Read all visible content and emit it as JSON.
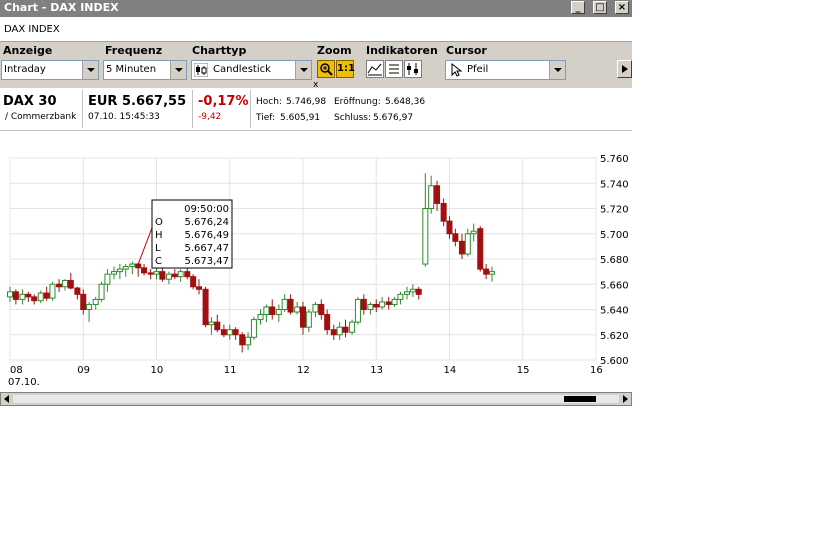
{
  "window": {
    "title": "Chart - DAX INDEX",
    "subtitle": "DAX INDEX"
  },
  "toolbar": {
    "anzeige_label": "Anzeige",
    "anzeige_value": "Intraday",
    "frequenz_label": "Frequenz",
    "frequenz_value": "5 Minuten",
    "charttyp_label": "Charttyp",
    "charttyp_value": "Candlestick",
    "zoom_label": "Zoom",
    "zoom_reset": "1:1",
    "indikatoren_label": "Indikatoren",
    "cursor_label": "Cursor",
    "cursor_value": "Pfeil",
    "close_x": "x"
  },
  "quote": {
    "name": "DAX 30",
    "exchange": "/ Commerzbank",
    "price": "EUR 5.667,55",
    "datetime": "07.10. 15:45:33",
    "change_pct": "-0,17%",
    "change_abs": "-9,42",
    "hoch_label": "Hoch:",
    "hoch_value": "5.746,98",
    "tief_label": "Tief:",
    "tief_value": "5.605,91",
    "eroeffnung_label": "Eröffnung:",
    "eroeffnung_value": "5.648,36",
    "schluss_label": "Schluss:",
    "schluss_value": "5.676,97"
  },
  "tooltip": {
    "time": "09:50:00",
    "O": "5.676,24",
    "H": "5.676,49",
    "L": "5.667,47",
    "C": "5.673,47"
  },
  "colors": {
    "up": "#2e8b2e",
    "down": "#a01010",
    "negative": "#c00000"
  },
  "chart_data": {
    "type": "candlestick",
    "y_ticks": [
      "5.760",
      "5.740",
      "5.720",
      "5.700",
      "5.680",
      "5.660",
      "5.640",
      "5.620",
      "5.600"
    ],
    "ylim": [
      5600,
      5760
    ],
    "x_ticks": [
      "08",
      "09",
      "10",
      "11",
      "12",
      "13",
      "14",
      "15",
      "16"
    ],
    "x_subtick": "07.10.",
    "grid": true,
    "xlim": [
      8,
      16
    ],
    "candles": [
      [
        8.0,
        5650,
        5658,
        5646,
        5654
      ],
      [
        8.08,
        5654,
        5656,
        5644,
        5648
      ],
      [
        8.17,
        5648,
        5656,
        5644,
        5652
      ],
      [
        8.25,
        5652,
        5654,
        5646,
        5650
      ],
      [
        8.33,
        5650,
        5652,
        5644,
        5647
      ],
      [
        8.42,
        5647,
        5655,
        5645,
        5653
      ],
      [
        8.5,
        5653,
        5658,
        5647,
        5649
      ],
      [
        8.58,
        5649,
        5662,
        5647,
        5660
      ],
      [
        8.67,
        5660,
        5664,
        5654,
        5658
      ],
      [
        8.75,
        5658,
        5664,
        5655,
        5663
      ],
      [
        8.83,
        5663,
        5669,
        5656,
        5657
      ],
      [
        8.92,
        5657,
        5658,
        5648,
        5652
      ],
      [
        9.0,
        5652,
        5656,
        5636,
        5640
      ],
      [
        9.08,
        5640,
        5646,
        5630,
        5644
      ],
      [
        9.17,
        5644,
        5650,
        5640,
        5648
      ],
      [
        9.25,
        5648,
        5662,
        5646,
        5660
      ],
      [
        9.33,
        5660,
        5672,
        5654,
        5668
      ],
      [
        9.42,
        5668,
        5674,
        5664,
        5670
      ],
      [
        9.5,
        5670,
        5676,
        5664,
        5672
      ],
      [
        9.58,
        5672,
        5676,
        5666,
        5674
      ],
      [
        9.67,
        5674,
        5678,
        5668,
        5676
      ],
      [
        9.75,
        5676,
        5677,
        5666,
        5673
      ],
      [
        9.83,
        5673,
        5676,
        5667,
        5669
      ],
      [
        9.92,
        5669,
        5672,
        5664,
        5668
      ],
      [
        10.0,
        5668,
        5674,
        5664,
        5670
      ],
      [
        10.08,
        5670,
        5674,
        5662,
        5664
      ],
      [
        10.17,
        5664,
        5670,
        5660,
        5668
      ],
      [
        10.25,
        5668,
        5672,
        5664,
        5666
      ],
      [
        10.33,
        5666,
        5672,
        5662,
        5670
      ],
      [
        10.42,
        5670,
        5674,
        5664,
        5666
      ],
      [
        10.5,
        5666,
        5668,
        5656,
        5658
      ],
      [
        10.58,
        5658,
        5664,
        5652,
        5656
      ],
      [
        10.67,
        5656,
        5658,
        5626,
        5628
      ],
      [
        10.75,
        5628,
        5634,
        5620,
        5630
      ],
      [
        10.83,
        5630,
        5636,
        5622,
        5624
      ],
      [
        10.92,
        5624,
        5628,
        5618,
        5620
      ],
      [
        11.0,
        5620,
        5628,
        5616,
        5624
      ],
      [
        11.08,
        5624,
        5626,
        5616,
        5620
      ],
      [
        11.17,
        5620,
        5622,
        5606,
        5612
      ],
      [
        11.25,
        5612,
        5622,
        5608,
        5618
      ],
      [
        11.33,
        5618,
        5634,
        5616,
        5632
      ],
      [
        11.42,
        5632,
        5640,
        5628,
        5636
      ],
      [
        11.5,
        5636,
        5644,
        5630,
        5642
      ],
      [
        11.58,
        5642,
        5648,
        5632,
        5636
      ],
      [
        11.67,
        5636,
        5644,
        5630,
        5640
      ],
      [
        11.75,
        5640,
        5652,
        5638,
        5648
      ],
      [
        11.83,
        5648,
        5652,
        5636,
        5638
      ],
      [
        11.92,
        5638,
        5646,
        5636,
        5642
      ],
      [
        12.0,
        5642,
        5646,
        5620,
        5626
      ],
      [
        12.08,
        5626,
        5640,
        5622,
        5638
      ],
      [
        12.17,
        5638,
        5646,
        5634,
        5644
      ],
      [
        12.25,
        5644,
        5648,
        5632,
        5636
      ],
      [
        12.33,
        5636,
        5640,
        5620,
        5624
      ],
      [
        12.42,
        5624,
        5628,
        5616,
        5620
      ],
      [
        12.5,
        5620,
        5630,
        5616,
        5626
      ],
      [
        12.58,
        5626,
        5632,
        5618,
        5622
      ],
      [
        12.67,
        5622,
        5632,
        5620,
        5630
      ],
      [
        12.75,
        5630,
        5650,
        5628,
        5648
      ],
      [
        12.83,
        5648,
        5652,
        5636,
        5640
      ],
      [
        12.92,
        5640,
        5646,
        5636,
        5644
      ],
      [
        13.0,
        5644,
        5648,
        5638,
        5642
      ],
      [
        13.08,
        5642,
        5650,
        5640,
        5646
      ],
      [
        13.17,
        5646,
        5650,
        5640,
        5644
      ],
      [
        13.25,
        5644,
        5650,
        5642,
        5648
      ],
      [
        13.33,
        5648,
        5654,
        5644,
        5652
      ],
      [
        13.42,
        5652,
        5658,
        5648,
        5654
      ],
      [
        13.5,
        5654,
        5660,
        5650,
        5656
      ],
      [
        13.58,
        5656,
        5658,
        5648,
        5652
      ],
      [
        13.67,
        5676,
        5748,
        5674,
        5720
      ],
      [
        13.75,
        5720,
        5746,
        5716,
        5738
      ],
      [
        13.83,
        5738,
        5742,
        5718,
        5724
      ],
      [
        13.92,
        5724,
        5728,
        5706,
        5710
      ],
      [
        14.0,
        5710,
        5714,
        5696,
        5700
      ],
      [
        14.08,
        5700,
        5704,
        5690,
        5694
      ],
      [
        14.17,
        5694,
        5700,
        5680,
        5684
      ],
      [
        14.25,
        5684,
        5704,
        5682,
        5700
      ],
      [
        14.33,
        5700,
        5708,
        5694,
        5702
      ],
      [
        14.42,
        5704,
        5706,
        5670,
        5672
      ],
      [
        14.5,
        5672,
        5676,
        5664,
        5668
      ],
      [
        14.58,
        5668,
        5674,
        5662,
        5670
      ]
    ]
  }
}
